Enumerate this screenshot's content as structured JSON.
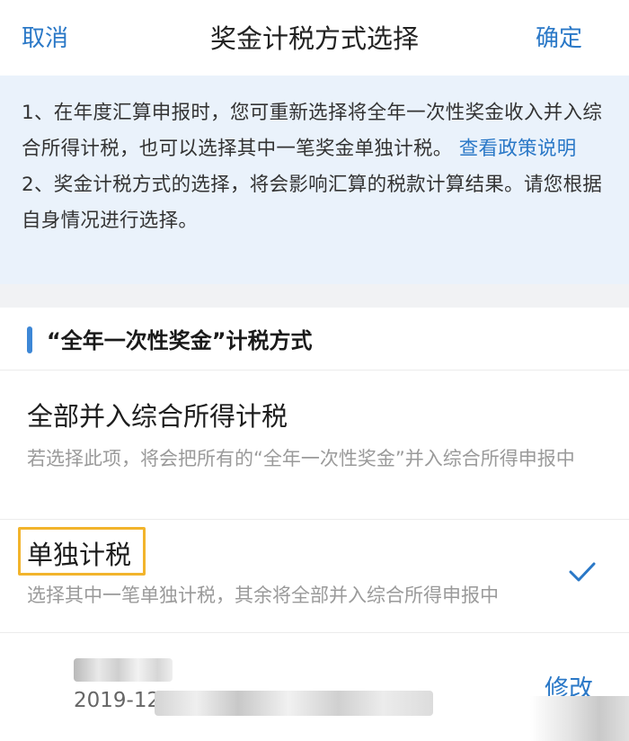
{
  "header": {
    "cancel_label": "取消",
    "title": "奖金计税方式选择",
    "confirm_label": "确定"
  },
  "notice": {
    "line1": "1、在年度汇算申报时，您可重新选择将全年一次性奖金收入并入综合所得计税，也可以选择其中一笔奖金单独计税。",
    "link": "查看政策说明",
    "line2": "2、奖金计税方式的选择，将会影响汇算的税款计算结果。请您根据自身情况进行选择。"
  },
  "section": {
    "title": "“全年一次性奖金”计税方式"
  },
  "options": [
    {
      "title": "全部并入综合所得计税",
      "desc": "若选择此项，将会把所有的“全年一次性奖金”并入综合所得申报中",
      "selected": false
    },
    {
      "title": "单独计税",
      "desc": "选择其中一笔单独计税，其余将全部并入综合所得申报中",
      "selected": true
    }
  ],
  "entry": {
    "date": "2019-12",
    "edit_label": "修改"
  },
  "colors": {
    "accent": "#2a78c7",
    "notice_bg": "#eaf2fb",
    "highlight": "#f2b42c"
  },
  "icons": {
    "selected": "checkmark-icon"
  }
}
